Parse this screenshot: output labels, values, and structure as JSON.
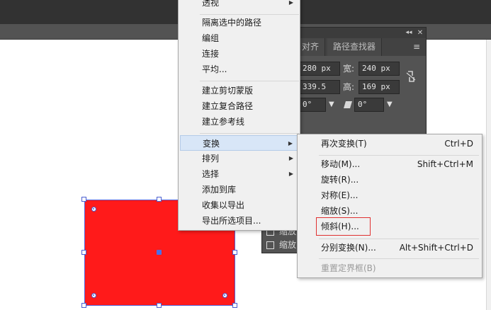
{
  "panel": {
    "tabs": [
      "对齐",
      "路径查找器"
    ],
    "collapse_glyph": "◂◂",
    "close_glyph": "✕",
    "menu_glyph": "≡",
    "x_value": "280 px",
    "w_label": "宽:",
    "w_value": "240 px",
    "y_value": "339.5 px",
    "h_label": "高:",
    "h_value": "169 px",
    "angle1": "0°",
    "angle2": "0°",
    "checkbox1": "缩放",
    "checkbox2": "缩放"
  },
  "main_menu": {
    "items": [
      {
        "label": "透视",
        "submenu": true
      },
      {
        "label": "隔离选中的路径"
      },
      {
        "label": "编组"
      },
      {
        "label": "连接"
      },
      {
        "label": "平均..."
      },
      {
        "label": "建立剪切蒙版"
      },
      {
        "label": "建立复合路径"
      },
      {
        "label": "建立参考线"
      },
      {
        "label": "变换",
        "submenu": true,
        "highlighted": true
      },
      {
        "label": "排列",
        "submenu": true
      },
      {
        "label": "选择",
        "submenu": true
      },
      {
        "label": "添加到库"
      },
      {
        "label": "收集以导出"
      },
      {
        "label": "导出所选项目..."
      }
    ]
  },
  "transform_menu": {
    "items": [
      {
        "label": "再次变换(T)",
        "shortcut": "Ctrl+D"
      },
      {
        "label": "移动(M)...",
        "shortcut": "Shift+Ctrl+M"
      },
      {
        "label": "旋转(R)..."
      },
      {
        "label": "对称(E)..."
      },
      {
        "label": "缩放(S)..."
      },
      {
        "label": "倾斜(H)...",
        "outlined": true
      },
      {
        "label": "分别变换(N)...",
        "shortcut": "Alt+Shift+Ctrl+D"
      },
      {
        "label": "重置定界框(B)",
        "disabled": true
      }
    ]
  },
  "colors": {
    "fill": "#ff1a1a",
    "selection": "#4a5ed0",
    "outline_box": "#e03030"
  }
}
